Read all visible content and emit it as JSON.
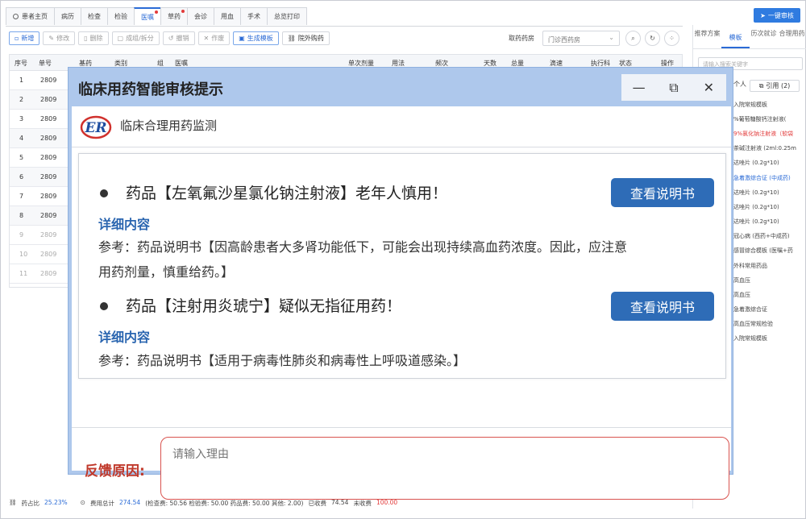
{
  "tabs": [
    {
      "label": "患者主页",
      "active": false,
      "dot": false
    },
    {
      "label": "病历",
      "active": false,
      "dot": false
    },
    {
      "label": "检查",
      "active": false,
      "dot": false
    },
    {
      "label": "检验",
      "active": false,
      "dot": false
    },
    {
      "label": "医嘱",
      "active": true,
      "dot": true
    },
    {
      "label": "草药",
      "active": false,
      "dot": true
    },
    {
      "label": "会诊",
      "active": false,
      "dot": false
    },
    {
      "label": "用血",
      "active": false,
      "dot": false
    },
    {
      "label": "手术",
      "active": false,
      "dot": false
    },
    {
      "label": "总览打印",
      "active": false,
      "dot": false
    }
  ],
  "audit_button": "一键审核",
  "toolbar": {
    "buttons": [
      "新增",
      "修改",
      "删除",
      "成组/拆分",
      "撤销",
      "作废",
      "生成模板",
      "院外购药"
    ],
    "pharmacy_label": "取药药房",
    "pharmacy_value": "门诊西药房"
  },
  "table": {
    "headers": [
      "序号",
      "单号",
      "基药",
      "类别",
      "组",
      "医嘱",
      "单次剂量",
      "用法",
      "频次",
      "天数",
      "总量",
      "滴速",
      "执行科",
      "状态",
      "操作"
    ],
    "rows": [
      {
        "no": "1",
        "code": "2809"
      },
      {
        "no": "2",
        "code": "2809"
      },
      {
        "no": "3",
        "code": "2809"
      },
      {
        "no": "4",
        "code": "2809"
      },
      {
        "no": "5",
        "code": "2809"
      },
      {
        "no": "6",
        "code": "2809"
      },
      {
        "no": "7",
        "code": "2809"
      },
      {
        "no": "8",
        "code": "2809"
      },
      {
        "no": "9",
        "code": "2809"
      },
      {
        "no": "10",
        "code": "2809"
      },
      {
        "no": "11",
        "code": "2809"
      }
    ]
  },
  "right_panel": {
    "tabs": [
      "推荐方案",
      "模板",
      "历次就诊",
      "合理用药"
    ],
    "search_placeholder": "请输入搜索关键字",
    "chip_label": "个人",
    "ref_button": "引用 (2)",
    "items": [
      "入院常规模板",
      "%葡萄糖酸钙注射液(",
      "9%氯化钠注射液（软袋",
      "茶碱注射液 (2ml:0.25m",
      "达唑片 (0.2g*10)",
      "急着激综合证 (中成药)",
      "达唑片 (0.2g*10)",
      "达唑片 (0.2g*10)",
      "达唑片 (0.2g*10)",
      "冠心病 (西药+中成药)",
      "感冒综合模板 (医嘱+药",
      "外科常用药品",
      "高血压",
      "高血压",
      "急着激综合证",
      "高血压常规检验",
      "入院常规模板"
    ]
  },
  "footer": {
    "drug_ratio_label": "药占比",
    "drug_ratio": "25.23%",
    "fee_label": "费用总计",
    "fee_total": "274.54",
    "breakdown": "(检查费: 50.56  检验费: 50.00  药品费: 50.00  其他: 2.00)",
    "collected_label": "已收费",
    "collected": "74.54",
    "uncollected_label": "未收费",
    "uncollected": "100.00"
  },
  "dialog": {
    "title": "临床用药智能审核提示",
    "subtitle": "临床合理用药监测",
    "logo_text": "ER",
    "messages": [
      {
        "title": "药品【左氧氟沙星氯化钠注射液】老年人慎用！",
        "detail_label": "详细内容",
        "reference_line1": "参考：药品说明书【因高龄患者大多肾功能低下，可能会出现持续高血药浓度。因此，应注意",
        "reference_line2": "用药剂量，慎重给药。】",
        "button": "查看说明书"
      },
      {
        "title": "药品【注射用炎琥宁】疑似无指征用药！",
        "detail_label": "详细内容",
        "reference_line1": "参考：药品说明书【适用于病毒性肺炎和病毒性上呼吸道感染。】",
        "button": "查看说明书"
      }
    ],
    "feedback_label": "反馈原因:",
    "feedback_placeholder": "请输入理由"
  }
}
